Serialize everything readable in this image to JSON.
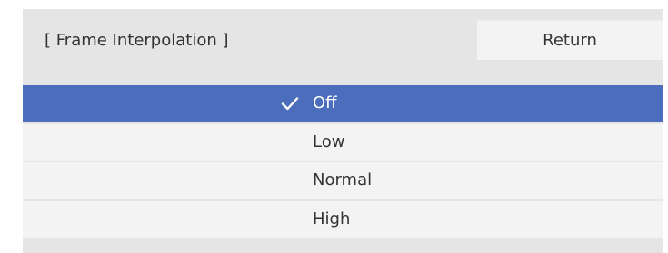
{
  "dialog": {
    "title": "[ Frame Interpolation ]",
    "return_label": "Return"
  },
  "options": [
    {
      "label": "Off",
      "selected": true
    },
    {
      "label": "Low",
      "selected": false
    },
    {
      "label": "Normal",
      "selected": false
    },
    {
      "label": "High",
      "selected": false
    }
  ],
  "colors": {
    "selected_row": "#4b6dbb",
    "row": "#f3f3f3",
    "panel": "#e5e5e5",
    "text": "#333333",
    "selected_text": "#ffffff"
  },
  "icons": {
    "selected_marker": "checkmark-icon"
  }
}
